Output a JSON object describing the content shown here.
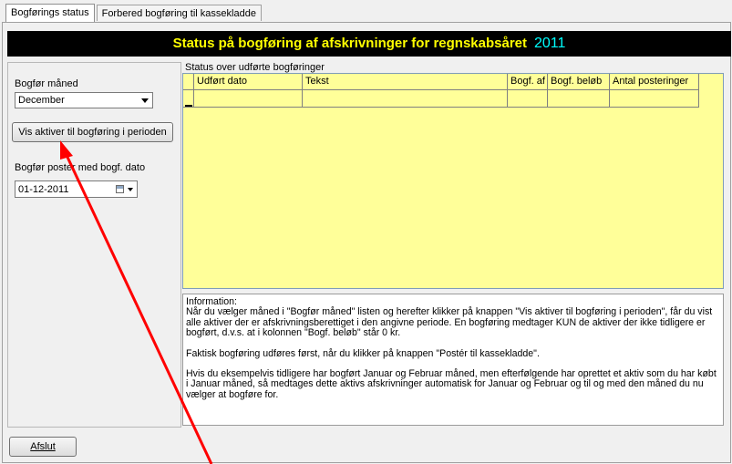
{
  "tabs": [
    "Bogførings status",
    "Forbered bogføring til kassekladde"
  ],
  "header": {
    "title": "Status på bogføring af afskrivninger for regnskabsåret",
    "year": "2011"
  },
  "left": {
    "month_label": "Bogfør måned",
    "month_value": "December",
    "show_button": "Vis aktiver til bogføring i perioden",
    "date_label": "Bogfør poster med bogf. dato",
    "date_value": "01-12-2011"
  },
  "grid": {
    "title": "Status over udførte bogføringer",
    "columns": [
      "Udført dato",
      "Tekst",
      "Bogf. af",
      "Bogf. beløb",
      "Antal posteringer"
    ]
  },
  "info": {
    "heading": "Information:",
    "p1": "Når du vælger måned i \"Bogfør måned\" listen og herefter klikker på knappen \"Vis aktiver til bogføring i perioden\", får du vist alle aktiver der er afskrivningsberettiget i den angivne periode. En bogføring medtager KUN de aktiver der ikke tidligere er bogført, d.v.s. at i kolonnen \"Bogf. beløb\" står 0 kr.",
    "p2": "Faktisk bogføring udføres først, når du klikker på knappen \"Postér til kassekladde\".",
    "p3": "Hvis du eksempelvis tidligere har bogført Januar og Februar måned, men efterfølgende har oprettet et aktiv som du har købt i Januar måned, så medtages dette aktivs afskrivninger automatisk for Januar og Februar og til og med den måned du nu vælger at bogføre for."
  },
  "footer": {
    "exit_button": "Afslut"
  },
  "colors": {
    "header_bg": "#000000",
    "header_text": "#ffff00",
    "year_text": "#00ffff",
    "grid_bg": "#ffff99",
    "annotation": "#ff0000"
  }
}
